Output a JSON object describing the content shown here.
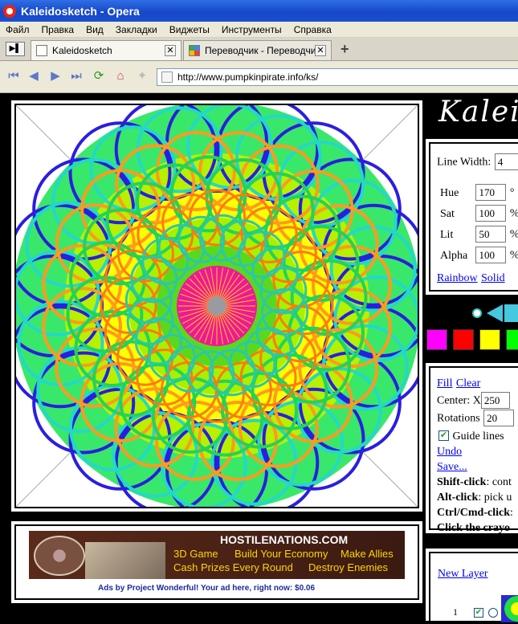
{
  "window": {
    "title": "Kaleidosketch - Opera"
  },
  "menu": [
    "Файл",
    "Правка",
    "Вид",
    "Закладки",
    "Виджеты",
    "Инструменты",
    "Справка"
  ],
  "tabs": [
    {
      "label": "Kaleidosketch",
      "close": "✕"
    },
    {
      "label": "Переводчик - Переводчи...",
      "close": "✕"
    }
  ],
  "new_tab": "+",
  "address": {
    "url": "http://www.pumpkinpirate.info/ks/"
  },
  "site": {
    "logo_text": "Kaleid"
  },
  "controls": {
    "line_width_label": "Line Width:",
    "line_width_value": "4",
    "hue_label": "Hue",
    "hue_value": "170",
    "hue_unit": "°",
    "sat_label": "Sat",
    "sat_value": "100",
    "sat_unit": "%",
    "lit_label": "Lit",
    "lit_value": "50",
    "lit_unit": "%",
    "alpha_label": "Alpha",
    "alpha_value": "100",
    "alpha_unit": "%",
    "rainbow_link": "Rainbow",
    "solid_link": "Solid"
  },
  "palette": {
    "colors": [
      "#ff00ff",
      "#ff0000",
      "#ffff00",
      "#00ff00"
    ]
  },
  "tools": {
    "fill_link": "Fill",
    "clear_link": "Clear",
    "center_label": "Center: X",
    "center_value": "250",
    "rotations_label": "Rotations",
    "rotations_value": "20",
    "guide_label": "Guide lines",
    "guide_checked": true,
    "undo_link": "Undo",
    "save_link": "Save...",
    "hint1_bold": "Shift-click",
    "hint1_rest": ": cont",
    "hint2_bold": "Alt-click",
    "hint2_rest": ": pick u",
    "hint3_bold": "Ctrl/Cmd-click",
    "hint3_rest": ":",
    "hint4": "Click the crayo"
  },
  "layers": {
    "new_layer_link": "New Layer",
    "first_layer_number": "1"
  },
  "ad": {
    "site": "HOSTILENATIONS.COM",
    "line1": [
      "3D Game",
      "Build Your Economy",
      "Make Allies"
    ],
    "line2": [
      "Cash Prizes Every Round",
      "Destroy Enemies"
    ],
    "footer": "Ads by Project Wonderful! Your ad here, right now: $0.06"
  }
}
